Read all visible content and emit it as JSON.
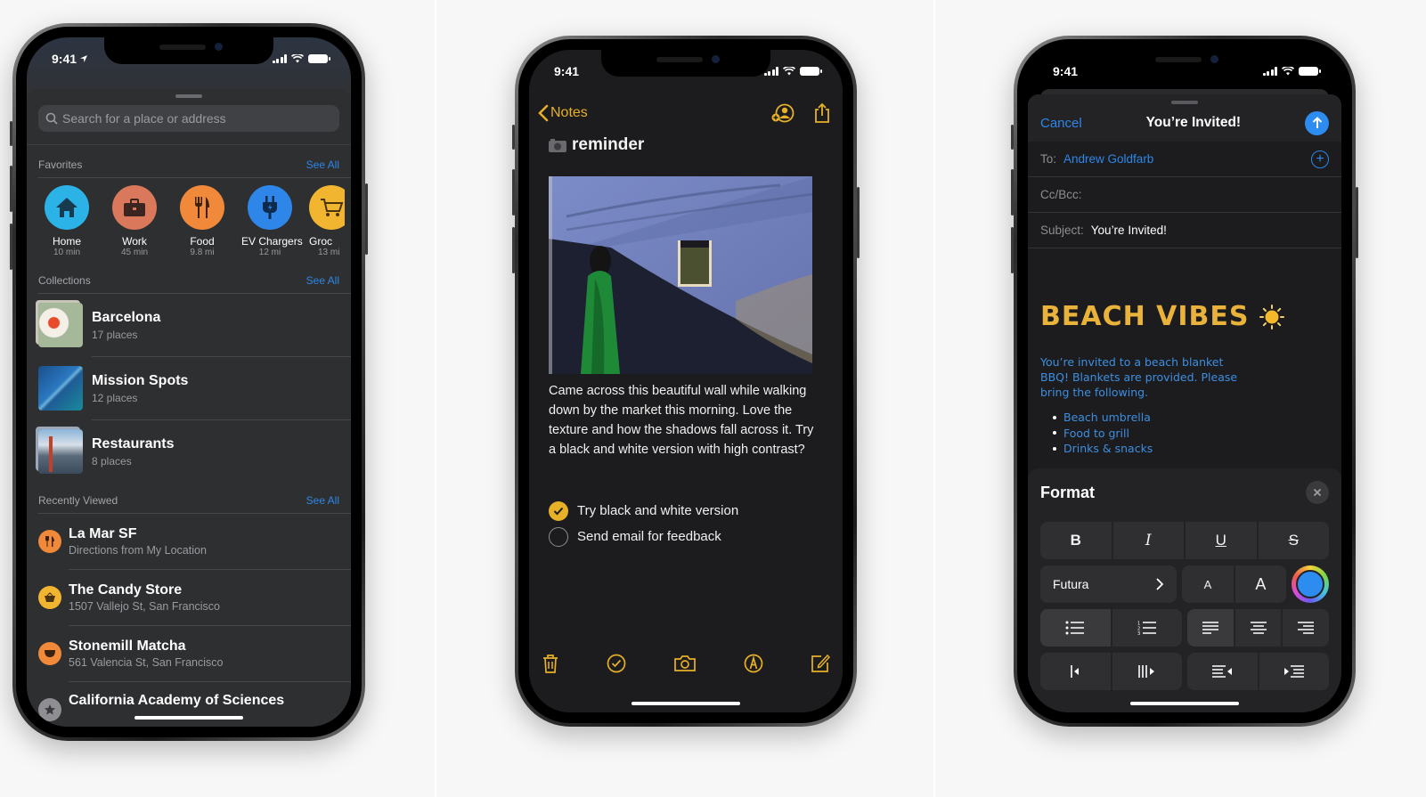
{
  "maps": {
    "status": {
      "time": "9:41"
    },
    "search": {
      "placeholder": "Search for a place or address"
    },
    "favorites": {
      "header": "Favorites",
      "see_all": "See All",
      "items": [
        {
          "name": "Home",
          "sub": "10 min",
          "icon": "house-icon",
          "color": "#2bb3e8"
        },
        {
          "name": "Work",
          "sub": "45 min",
          "icon": "briefcase-icon",
          "color": "#d9785a"
        },
        {
          "name": "Food",
          "sub": "9.8 mi",
          "icon": "fork-knife-icon",
          "color": "#f0893a"
        },
        {
          "name": "EV Chargers",
          "sub": "12 mi",
          "icon": "plug-icon",
          "color": "#2e86e8"
        },
        {
          "name": "Groc",
          "sub": "13 mi",
          "icon": "cart-icon",
          "color": "#f2b530"
        }
      ]
    },
    "collections": {
      "header": "Collections",
      "see_all": "See All",
      "items": [
        {
          "title": "Barcelona",
          "sub": "17 places"
        },
        {
          "title": "Mission Spots",
          "sub": "12 places"
        },
        {
          "title": "Restaurants",
          "sub": "8 places"
        }
      ]
    },
    "recent": {
      "header": "Recently Viewed",
      "see_all": "See All",
      "items": [
        {
          "title": "La Mar SF",
          "sub": "Directions from My Location",
          "icon": "fork-knife-icon",
          "color": "#f0893a"
        },
        {
          "title": "The Candy Store",
          "sub": "1507 Vallejo St, San Francisco",
          "icon": "basket-icon",
          "color": "#f2b530"
        },
        {
          "title": "Stonemill Matcha",
          "sub": "561 Valencia St, San Francisco",
          "icon": "cup-icon",
          "color": "#f0893a"
        },
        {
          "title": "California Academy of Sciences",
          "sub": "",
          "icon": "star-icon",
          "color": "#8e8e93"
        }
      ]
    }
  },
  "notes": {
    "status": {
      "time": "9:41"
    },
    "back_label": "Notes",
    "title": "reminder",
    "body": "Came across this beautiful wall while walking down by the market this morning. Love the texture and how the shadows fall across it. Try a black and white version with high contrast?",
    "checklist": [
      {
        "label": "Try black and white version",
        "done": true
      },
      {
        "label": "Send email for feedback",
        "done": false
      }
    ],
    "accent": "#e6b028"
  },
  "mail": {
    "status": {
      "time": "9:41"
    },
    "cancel_label": "Cancel",
    "header_title": "You’re Invited!",
    "to_label": "To:",
    "to_value": "Andrew Goldfarb",
    "cc_label": "Cc/Bcc:",
    "subject_label": "Subject:",
    "subject_value": "You’re Invited!",
    "headline": "BEACH VIBES",
    "body": "You’re invited to a beach blanket BBQ! Blankets are provided. Please bring the following.",
    "list": [
      "Beach umbrella",
      "Food to grill",
      "Drinks & snacks"
    ],
    "format": {
      "title": "Format",
      "bold": "B",
      "italic": "I",
      "underline": "U",
      "strike": "S",
      "font": "Futura",
      "size_small": "A",
      "size_large": "A",
      "selected_color": "#2d8cf0"
    },
    "accent": "#2e86e8"
  }
}
